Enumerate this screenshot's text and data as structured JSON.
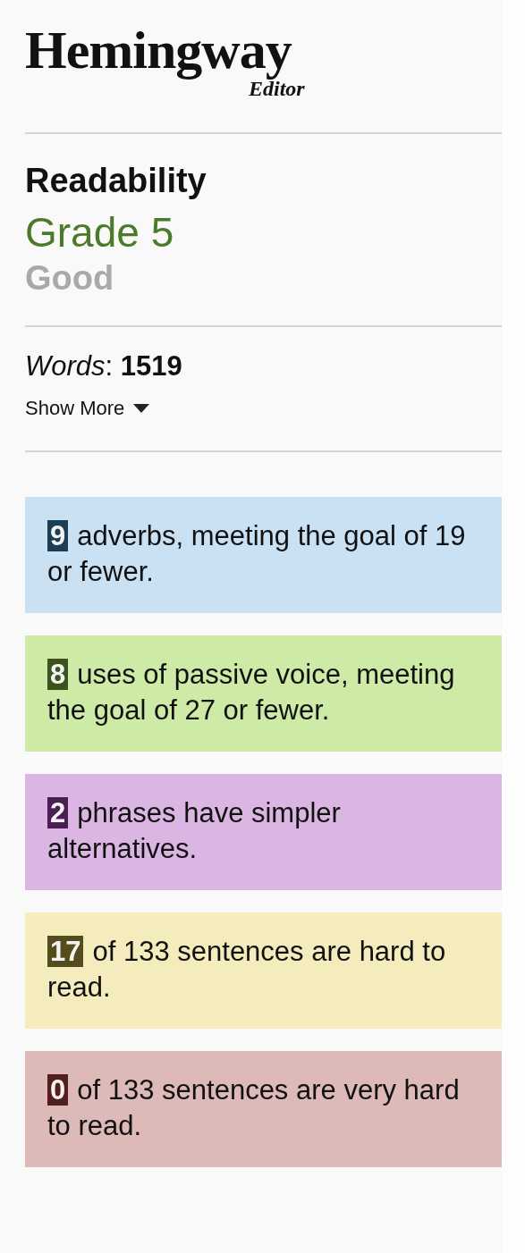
{
  "logo": {
    "name": "Hemingway",
    "subtitle": "Editor"
  },
  "readability": {
    "heading": "Readability",
    "grade": "Grade 5",
    "rating": "Good"
  },
  "words": {
    "text": "*Words*: **1519**"
  },
  "show_more": {
    "label": "Show More",
    "expanded": false
  },
  "highlights": [
    {
      "count": "9",
      "text": "adverbs, meeting the goal of 19 or fewer.",
      "color": "#c9e1f2"
    },
    {
      "count": "8",
      "text": "uses of passive voice, meeting the goal of 27 or fewer.",
      "color": "#cdeba6"
    },
    {
      "count": "2",
      "text": "phrases have simpler alternatives.",
      "color": "#dcb6e3"
    },
    {
      "count": "17",
      "text": "of 133 sentences are hard to read.",
      "color": "#f4ecbd"
    },
    {
      "count": "0",
      "text": "of 133 sentences are very hard to read.",
      "color": "#ddb9b8"
    }
  ]
}
